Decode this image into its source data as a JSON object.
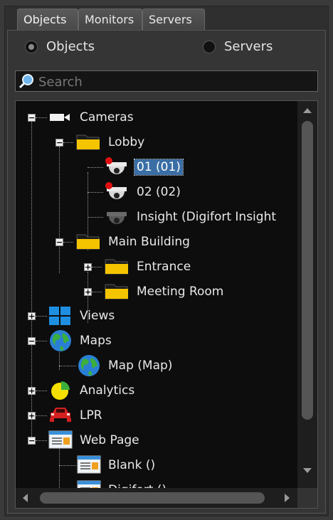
{
  "tabs": [
    {
      "label": "Objects",
      "active": true
    },
    {
      "label": "Monitors",
      "active": false
    },
    {
      "label": "Servers",
      "active": false
    }
  ],
  "view_mode": {
    "options": [
      {
        "label": "Objects",
        "selected": true
      },
      {
        "label": "Servers",
        "selected": false
      }
    ]
  },
  "search": {
    "placeholder": "Search",
    "value": ""
  },
  "tree": {
    "cameras": {
      "label": "Cameras",
      "expanded": true
    },
    "lobby": {
      "label": "Lobby",
      "expanded": true
    },
    "cam1": {
      "label": "01 (01)",
      "selected": true
    },
    "cam2": {
      "label": "02 (02)"
    },
    "insight": {
      "label": "Insight (Digifort Insight"
    },
    "main_building": {
      "label": "Main Building",
      "expanded": true
    },
    "entrance": {
      "label": "Entrance",
      "expanded": false
    },
    "meeting_room": {
      "label": "Meeting Room",
      "expanded": false
    },
    "views": {
      "label": "Views",
      "expanded": false
    },
    "maps": {
      "label": "Maps",
      "expanded": true
    },
    "map": {
      "label": "Map (Map)"
    },
    "analytics": {
      "label": "Analytics",
      "expanded": false
    },
    "lpr": {
      "label": "LPR",
      "expanded": false
    },
    "web_page": {
      "label": "Web Page",
      "expanded": true
    },
    "blank": {
      "label": "Blank ()"
    },
    "digifort": {
      "label": "Digifort ()"
    }
  },
  "colors": {
    "selection": "#3a6ea5",
    "tree_bg": "#0d0d0d",
    "panel_bg": "#353535",
    "folder": "#f5c400",
    "alert_red": "#e01010"
  }
}
